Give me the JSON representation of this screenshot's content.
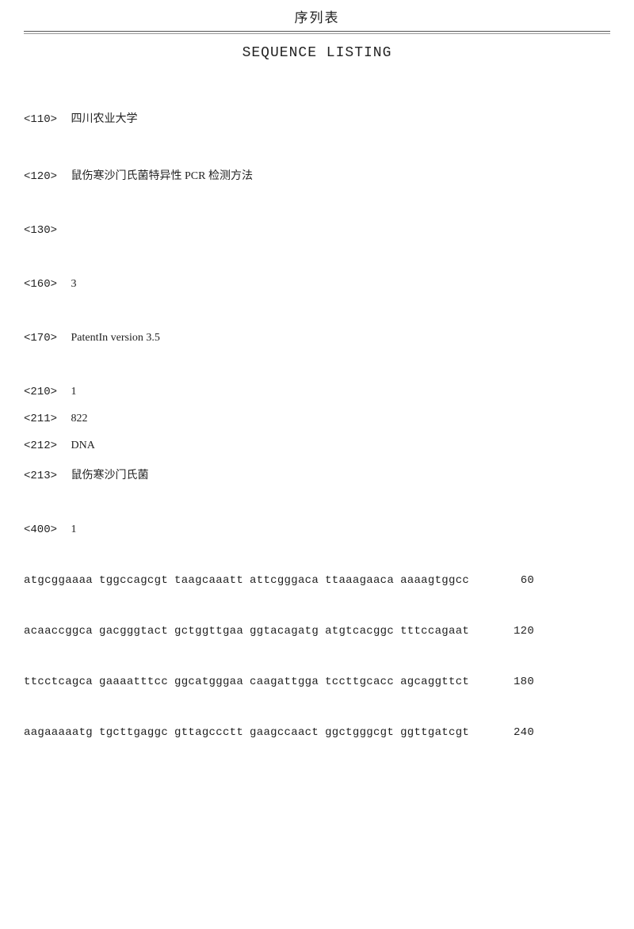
{
  "header": {
    "title_cn": "序列表",
    "title_en": "SEQUENCE LISTING"
  },
  "entries": {
    "e110": {
      "tag": "<110>",
      "value": "四川农业大学"
    },
    "e120": {
      "tag": "<120>",
      "value": "鼠伤寒沙门氏菌特异性 PCR 检测方法"
    },
    "e130": {
      "tag": "<130>",
      "value": ""
    },
    "e160": {
      "tag": "<160>",
      "value": "3"
    },
    "e170": {
      "tag": "<170>",
      "value": "PatentIn version 3.5"
    },
    "e210": {
      "tag": "<210>",
      "value": "1"
    },
    "e211": {
      "tag": "<211>",
      "value": "822"
    },
    "e212": {
      "tag": "<212>",
      "value": "DNA"
    },
    "e213": {
      "tag": "<213>",
      "value": "鼠伤寒沙门氏菌"
    },
    "e400": {
      "tag": "<400>",
      "value": "1"
    }
  },
  "sequence": [
    {
      "groups": [
        "atgcggaaaa",
        "tggccagcgt",
        "taagcaaatt",
        "attcgggaca",
        "ttaaagaaca",
        "aaaagtggcc"
      ],
      "num": "60"
    },
    {
      "groups": [
        "acaaccggca",
        "gacgggtact",
        "gctggttgaa",
        "ggtacagatg",
        "atgtcacggc",
        "tttccagaat"
      ],
      "num": "120"
    },
    {
      "groups": [
        "ttcctcagca",
        "gaaaatttcc",
        "ggcatgggaa",
        "caagattgga",
        "tccttgcacc",
        "agcaggttct"
      ],
      "num": "180"
    },
    {
      "groups": [
        "aagaaaaatg",
        "tgcttgaggc",
        "gttagccctt",
        "gaagccaact",
        "ggctgggcgt",
        "ggttgatcgt"
      ],
      "num": "240"
    }
  ]
}
